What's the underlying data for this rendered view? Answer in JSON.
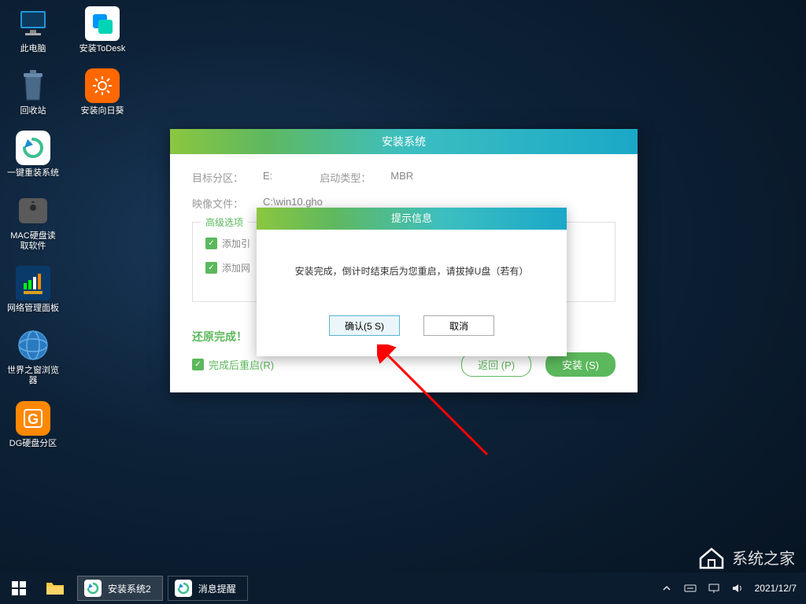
{
  "desktop_icons": {
    "this_pc": "此电脑",
    "todesk": "安装ToDesk",
    "recycle": "回收站",
    "sunflower": "安装向日葵",
    "reinstall": "一键重装系统",
    "mac_read": "MAC硬盘读取软件",
    "netpanel": "网络管理面板",
    "browser": "世界之窗浏览器",
    "dg": "DG硬盘分区"
  },
  "installer": {
    "title": "安装系统",
    "target_label": "目标分区：",
    "target_value": "E:",
    "boot_label": "启动类型：",
    "boot_value": "MBR",
    "image_label": "映像文件：",
    "image_value": "C:\\win10.gho",
    "advanced_legend": "高级选项",
    "add1": "添加引",
    "add2": "添加网",
    "restore_complete": "还原完成！",
    "restart_label": "完成后重启(R)",
    "back_btn": "返回 (P)",
    "install_btn": "安装 (S)"
  },
  "modal": {
    "title": "提示信息",
    "message": "安装完成，倒计时结束后为您重启，请拔掉U盘（若有）",
    "confirm": "确认(5 S)",
    "cancel": "取消"
  },
  "taskbar": {
    "task1": "安装系统2",
    "task2": "消息提醒",
    "date": "2021/12/7"
  },
  "watermark": "系统之家"
}
